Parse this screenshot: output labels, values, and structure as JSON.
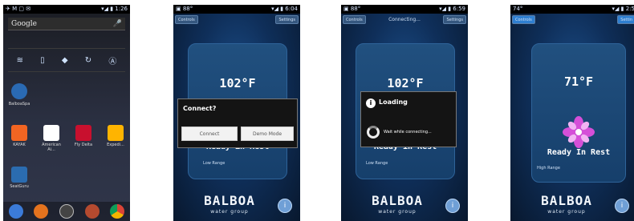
{
  "colors": {
    "accent": "#6f9fd6",
    "panel": "#21507f",
    "flower": "#d54fd8"
  },
  "screens": {
    "home": {
      "status_left": "✈ M ▢ ✉",
      "status_right": "▾◢ ▮ 1:26",
      "search": {
        "placeholder": "Google",
        "icon": "mic-icon"
      },
      "quick_settings": [
        "wifi-icon",
        "bluetooth-icon",
        "data-icon",
        "sync-icon",
        "brightness-icon"
      ],
      "apps": [
        {
          "label": "BalboaSpa",
          "color": "#2a6ab3"
        },
        {
          "label": "KAYAK",
          "color": "#f26522"
        },
        {
          "label": "American Ai...",
          "color": "#ffffff"
        },
        {
          "label": "Fly Delta",
          "color": "#c8102e"
        },
        {
          "label": "Expedi...",
          "color": "#ffb400"
        },
        {
          "label": "SeatGuru",
          "color": "#2b6cb0"
        }
      ],
      "dock": [
        "phone-icon",
        "firefox-icon",
        "apps-icon",
        "game-icon",
        "chrome-icon"
      ]
    },
    "connect": {
      "status_left": "▣ 88°",
      "status_right": "▾◢ ▮ 6:04",
      "controls": "Controls",
      "settings": "Settings",
      "temp": "102°F",
      "ready": "Ready in Rest",
      "range": "Low Range",
      "dialog_title": "Connect?",
      "btn_connect": "Connect",
      "btn_demo": "Demo Mode",
      "logo": "BALBOA",
      "logo_sub": "water group"
    },
    "loading": {
      "status_left": "▣ 88°",
      "status_right": "▾◢ ▮ 6:59",
      "controls": "Controls",
      "title": "Connecting...",
      "settings": "Settings",
      "temp": "102°F",
      "ready": "Ready in Rest",
      "range": "Low Range",
      "dialog_title": "Loading",
      "dialog_msg": "Wait while connecting...",
      "logo": "BALBOA",
      "logo_sub": "water group"
    },
    "ready": {
      "status_left": "74°",
      "status_right": "▾◢ ▮ 2:5",
      "controls": "Controls",
      "settings": "Settin",
      "temp": "71°F",
      "ready": "Ready In Rest",
      "range": "High Range",
      "logo": "BALBOA",
      "logo_sub": "water group"
    }
  }
}
